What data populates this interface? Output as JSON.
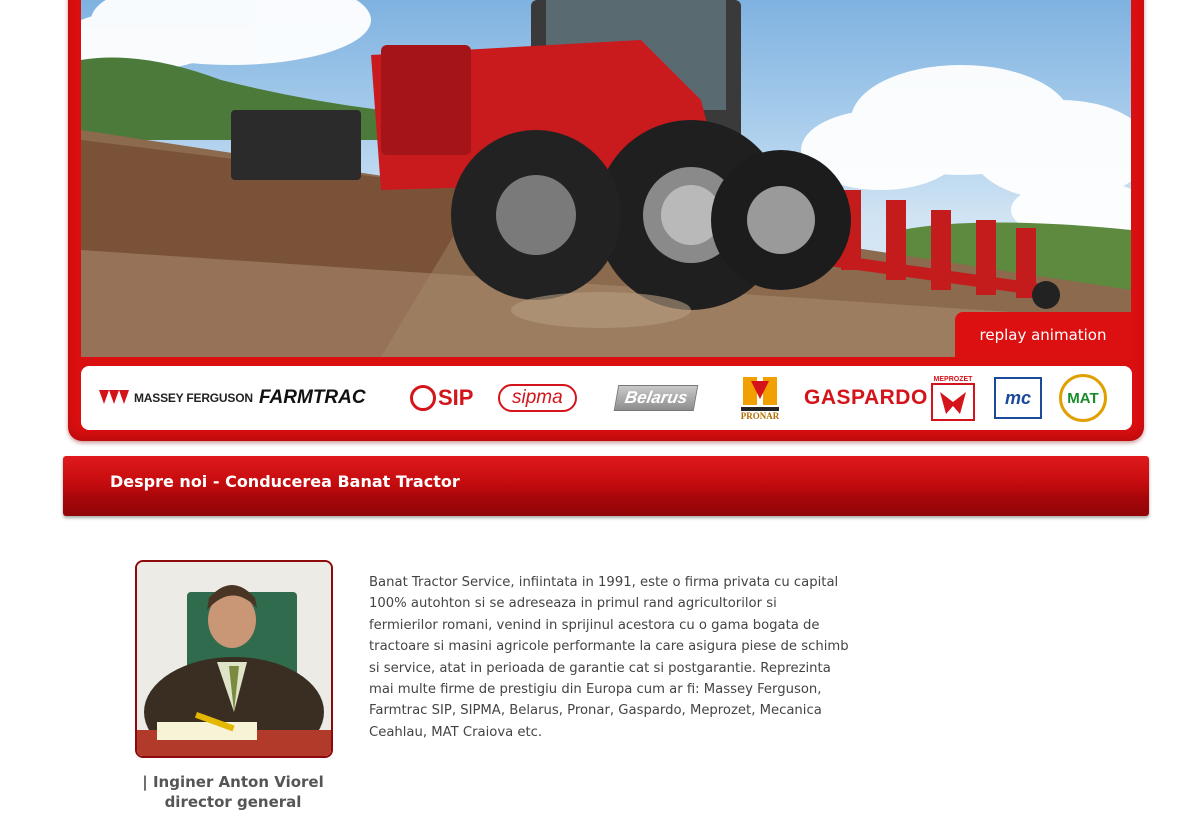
{
  "hero": {
    "replay_label": "replay animation"
  },
  "brands": [
    {
      "name": "MASSEY FERGUSON",
      "icon": "massey-ferguson-logo"
    },
    {
      "name": "FARMTRAC",
      "icon": "farmtrac-logo"
    },
    {
      "name": "SIP",
      "icon": "sip-logo"
    },
    {
      "name": "sipma",
      "icon": "sipma-logo"
    },
    {
      "name": "Belarus",
      "icon": "belarus-logo"
    },
    {
      "name": "PRONAR",
      "icon": "pronar-logo"
    },
    {
      "name": "GASPARDO",
      "icon": "gaspardo-logo"
    },
    {
      "name": "MEPROZET",
      "icon": "meprozet-logo"
    },
    {
      "name": "mc",
      "icon": "mecanica-ceahlau-logo"
    },
    {
      "name": "MAT",
      "icon": "mat-craiova-logo"
    }
  ],
  "section": {
    "title": "Despre noi - Conducerea Banat Tractor"
  },
  "profile": {
    "name_line": "| Inginer Anton Viorel",
    "role_line": "director general"
  },
  "about": {
    "text": "Banat Tractor Service, infiintata in 1991, este o firma privata cu capital 100% autohton si se adreseaza in primul rand agricultorilor si fermierilor romani, venind in sprijinul acestora cu o gama bogata de tractoare si masini agricole performante la care asigura piese de schimb si service, atat in perioada de garantie cat si postgarantie. Reprezinta mai multe firme de prestigiu din Europa cum ar fi: Massey Ferguson, Farmtrac SIP, SIPMA, Belarus, Pronar, Gaspardo, Meprozet, Mecanica Ceahlau, MAT Craiova etc."
  },
  "colors": {
    "brand_red": "#d90f10",
    "title_bar_dark": "#8f0408",
    "text": "#444444"
  }
}
